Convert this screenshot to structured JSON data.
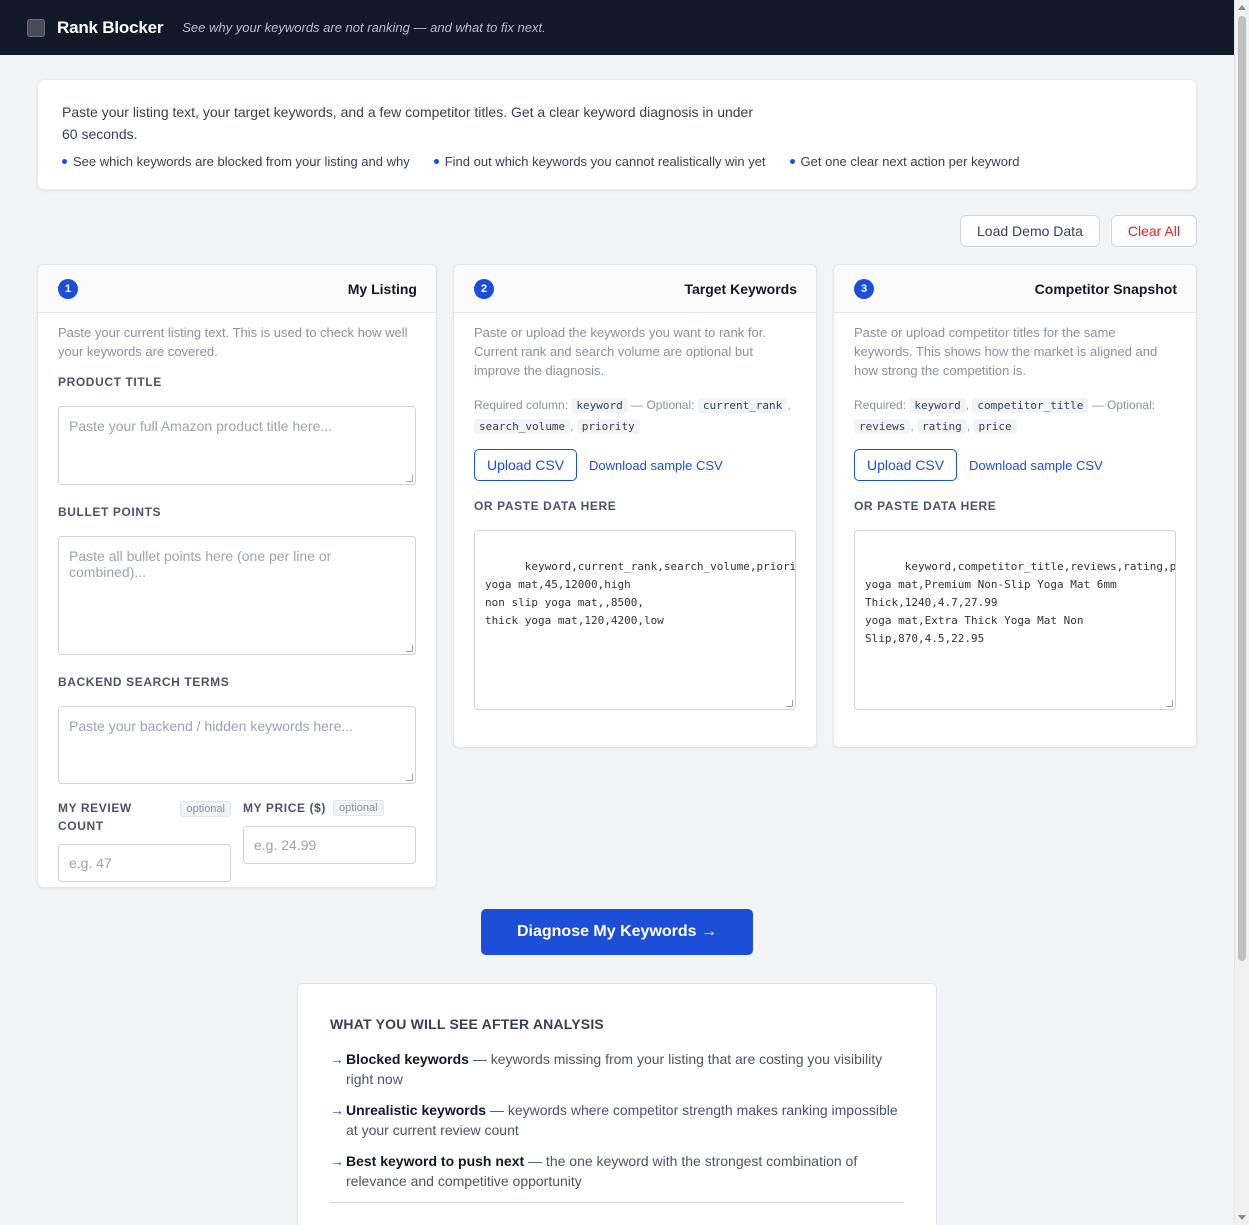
{
  "app": {
    "name": "Rank Blocker",
    "tagline": "See why your keywords are not ranking — and what to fix next."
  },
  "intro": {
    "text": "Paste your listing text, your target keywords, and a few competitor titles. Get a clear keyword diagnosis in under 60 seconds.",
    "benefits": [
      "See which keywords are blocked from your listing and why",
      "Find out which keywords you cannot realistically win yet",
      "Get one clear next action per keyword"
    ]
  },
  "toolbar": {
    "load_demo": "Load Demo Data",
    "clear_all": "Clear All"
  },
  "listing": {
    "step": "1",
    "title": "My Listing",
    "desc": "Paste your current listing text. This is used to check how well your keywords are covered.",
    "product_title_label": "PRODUCT TITLE",
    "product_title_placeholder": "Paste your full Amazon product title here...",
    "bullets_label": "BULLET POINTS",
    "bullets_placeholder": "Paste all bullet points here (one per line or combined)...",
    "backend_label": "BACKEND SEARCH TERMS",
    "backend_placeholder": "Paste your backend / hidden keywords here...",
    "review_label": "MY REVIEW COUNT",
    "review_badge": "optional",
    "review_placeholder": "e.g. 47",
    "price_label": "MY PRICE ($)",
    "price_badge": "optional",
    "price_placeholder": "e.g. 24.99"
  },
  "keywords": {
    "step": "2",
    "title": "Target Keywords",
    "desc": "Paste or upload the keywords you want to rank for. Current rank and search volume are optional but improve the diagnosis.",
    "req_prefix": "Required column:",
    "req_optional": "— Optional:",
    "cols": [
      "keyword",
      "current_rank",
      "search_volume",
      "priority"
    ],
    "upload": "Upload CSV",
    "sample": "Download sample CSV",
    "paste_label": "OR PASTE DATA HERE",
    "csv": "keyword,current_rank,search_volume,priority\nyoga mat,45,12000,high\nnon slip yoga mat,,8500,\nthick yoga mat,120,4200,low"
  },
  "competitors": {
    "step": "3",
    "title": "Competitor Snapshot",
    "desc": "Paste or upload competitor titles for the same keywords. This shows how the market is aligned and how strong the competition is.",
    "req_prefix": "Required:",
    "req_optional": "— Optional:",
    "cols": [
      "keyword",
      "competitor_title",
      "reviews",
      "rating",
      "price"
    ],
    "upload": "Upload CSV",
    "sample": "Download sample CSV",
    "paste_label": "OR PASTE DATA HERE",
    "csv": "keyword,competitor_title,reviews,rating,price\nyoga mat,Premium Non-Slip Yoga Mat 6mm\nThick,1240,4.7,27.99\nyoga mat,Extra Thick Yoga Mat Non\nSlip,870,4.5,22.95"
  },
  "diagnose_button": "Diagnose My Keywords →",
  "preview": {
    "heading": "WHAT YOU WILL SEE AFTER ANALYSIS",
    "items": [
      {
        "arrow": "→",
        "bold": "Blocked keywords",
        "text": " — keywords missing from your listing that are costing you visibility right now"
      },
      {
        "arrow": "→",
        "bold": "Unrealistic keywords",
        "text": " — keywords where competitor strength makes ranking impossible at your current review count"
      },
      {
        "arrow": "→",
        "bold": "Best keyword to push next",
        "text": " — the one keyword with the strongest combination of relevance and competitive opportunity"
      }
    ]
  },
  "colors": {
    "accent": "#1d4ed8",
    "topbar": "#111827",
    "danger": "#dc2626"
  }
}
